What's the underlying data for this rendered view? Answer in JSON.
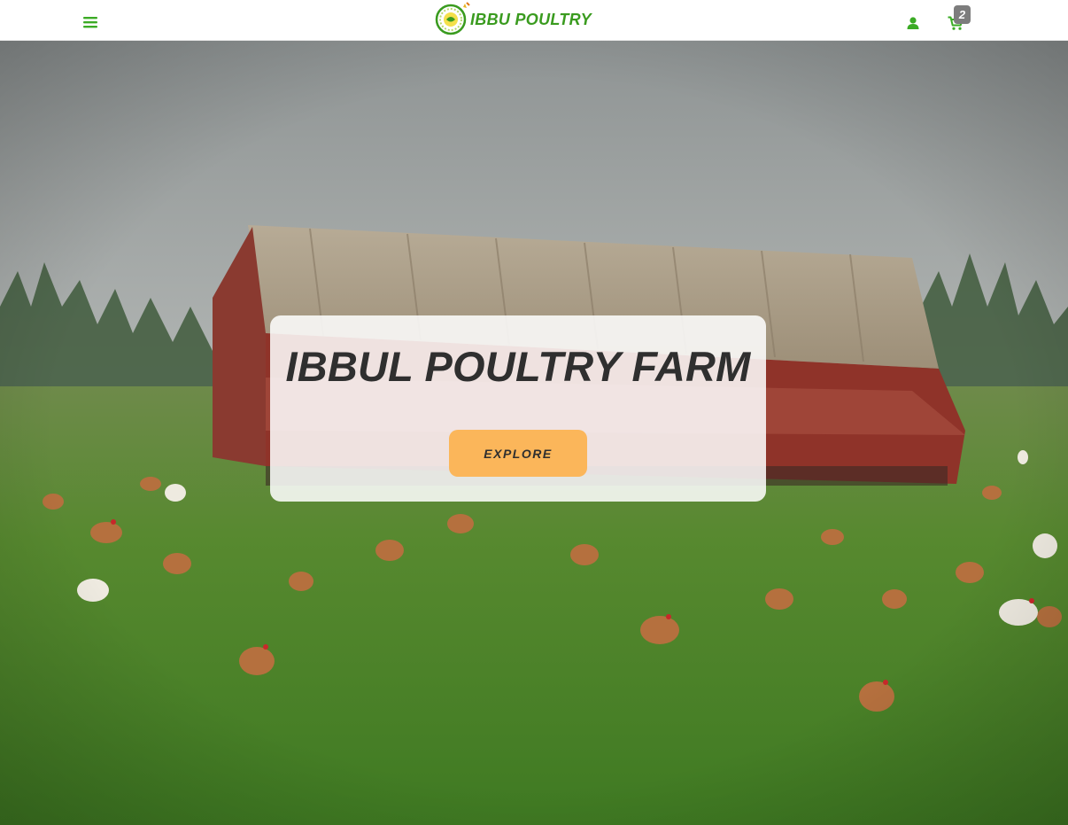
{
  "header": {
    "logo_text": "IBBU POULTRY",
    "menu_icon": "hamburger-menu-icon",
    "user_icon": "user-icon",
    "cart_icon": "shopping-cart-icon",
    "cart_count": "2"
  },
  "hero": {
    "title": "IBBUL POULTRY FARM",
    "explore_label": "EXPLORE"
  },
  "colors": {
    "brand_green": "#3a9b1f",
    "accent_orange": "#fbb65a",
    "badge_gray": "#7d7d7d",
    "title_text": "#2f2f2f"
  }
}
